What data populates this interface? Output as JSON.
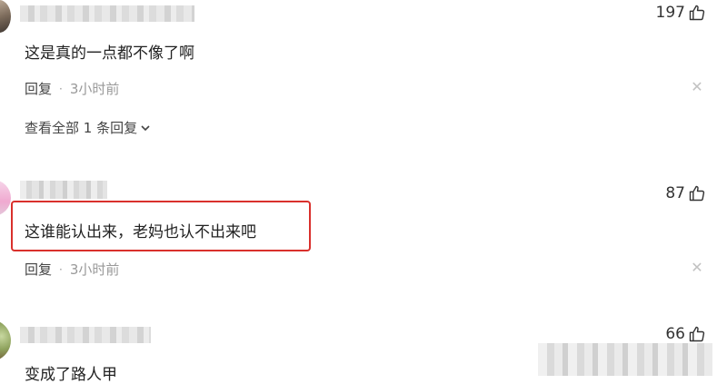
{
  "comments": [
    {
      "text": "这是真的一点都不像了啊",
      "likes": "197",
      "reply_label": "回复",
      "separator": "·",
      "time": "3小时前",
      "view_all": "查看全部 1 条回复"
    },
    {
      "text": "这谁能认出来，老妈也认不出来吧",
      "likes": "87",
      "reply_label": "回复",
      "separator": "·",
      "time": "3小时前"
    },
    {
      "text": "变成了路人甲",
      "likes": "66"
    }
  ],
  "icons": {
    "like": "thumbs-up-icon",
    "close": "close-icon",
    "expand": "chevron-down-icon"
  },
  "colors": {
    "highlight_border": "#d9302c",
    "muted_text": "#999999"
  }
}
